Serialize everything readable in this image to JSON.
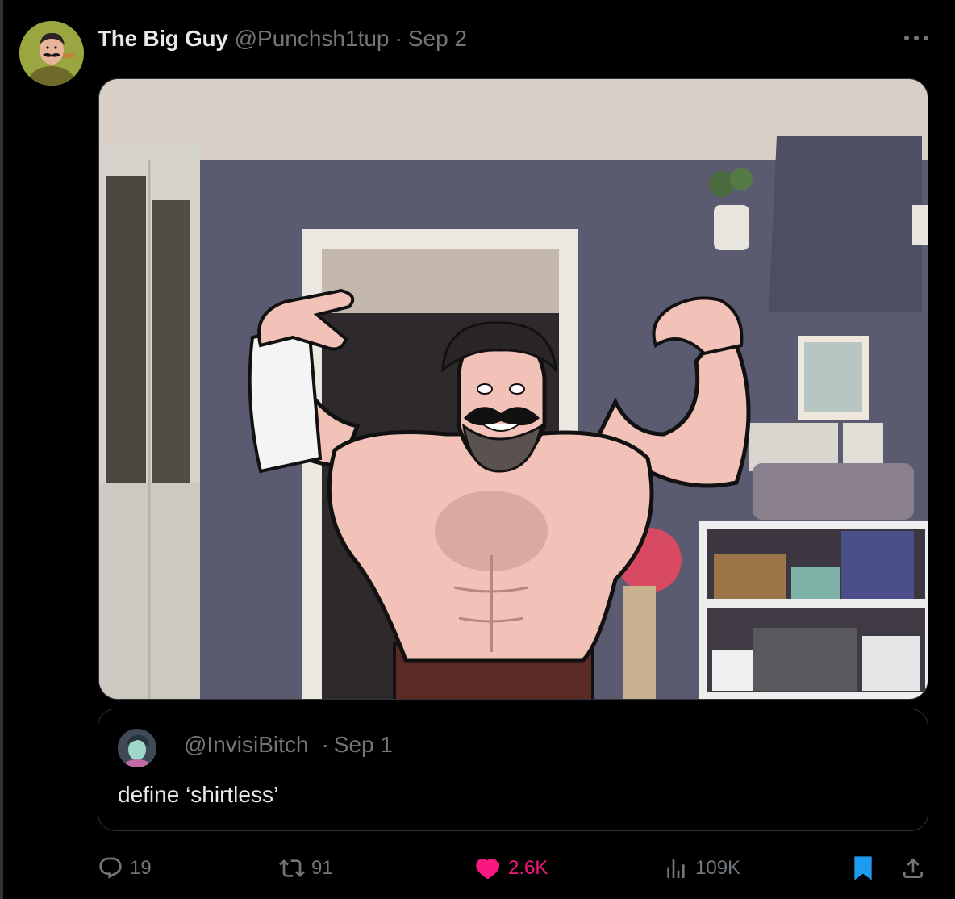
{
  "tweet": {
    "display_name": "The Big Guy",
    "handle": "@Punchsh1tup",
    "separator": "·",
    "date": "Sep 2",
    "more_label": "···"
  },
  "quote": {
    "handle": "@InvisiBitch",
    "separator": "·",
    "date": "Sep 1",
    "text": "define ‘shirtless’"
  },
  "actions": {
    "replies": "19",
    "retweets": "91",
    "likes": "2.6K",
    "views": "109K"
  },
  "colors": {
    "background": "#000000",
    "text_primary": "#e7e9ea",
    "text_secondary": "#71767b",
    "like": "#f91880",
    "bookmark": "#1d9bf0",
    "border": "#2f3336"
  },
  "icons": {
    "reply": "reply-icon",
    "retweet": "retweet-icon",
    "like": "heart-icon",
    "views": "views-icon",
    "bookmark": "bookmark-icon",
    "share": "share-icon",
    "more": "more-icon"
  }
}
